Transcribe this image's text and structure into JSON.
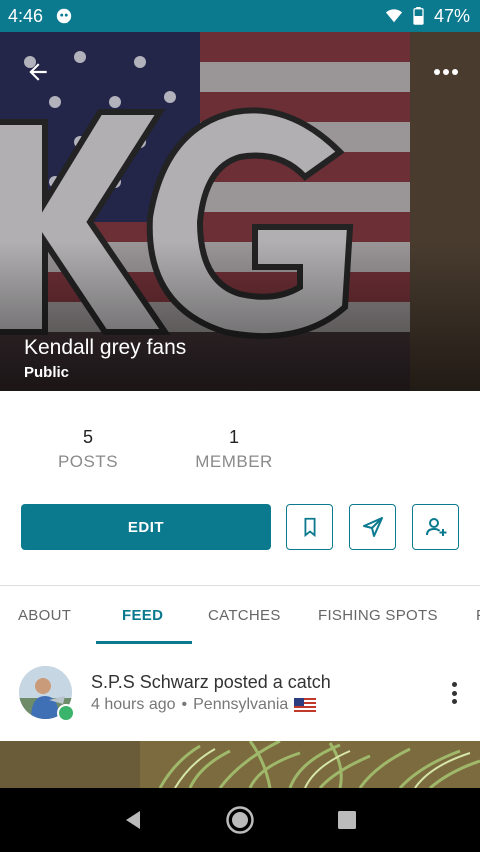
{
  "status_bar": {
    "time": "4:46",
    "battery": "47%",
    "icons": [
      "notification-icon",
      "wifi-icon",
      "battery-icon"
    ]
  },
  "group": {
    "name": "Kendall grey fans",
    "visibility": "Public"
  },
  "stats": {
    "posts_count": "5",
    "posts_label": "POSTS",
    "member_count": "1",
    "member_label": "MEMBER"
  },
  "actions": {
    "edit_label": "EDIT",
    "icons": [
      "bookmark-icon",
      "send-icon",
      "add-member-icon"
    ]
  },
  "tabs": [
    {
      "label": "ABOUT"
    },
    {
      "label": "FEED",
      "active": true
    },
    {
      "label": "CATCHES"
    },
    {
      "label": "FISHING SPOTS"
    },
    {
      "label": "F"
    }
  ],
  "feed": {
    "items": [
      {
        "title": "S.P.S Schwarz posted a catch",
        "time": "4 hours ago",
        "separator": "•",
        "location": "Pennsylvania"
      }
    ]
  },
  "colors": {
    "brand": "#0b7a8f",
    "status_bar": "#0b7a8f",
    "nav_bar": "#000000",
    "badge_green": "#3bb46b"
  }
}
